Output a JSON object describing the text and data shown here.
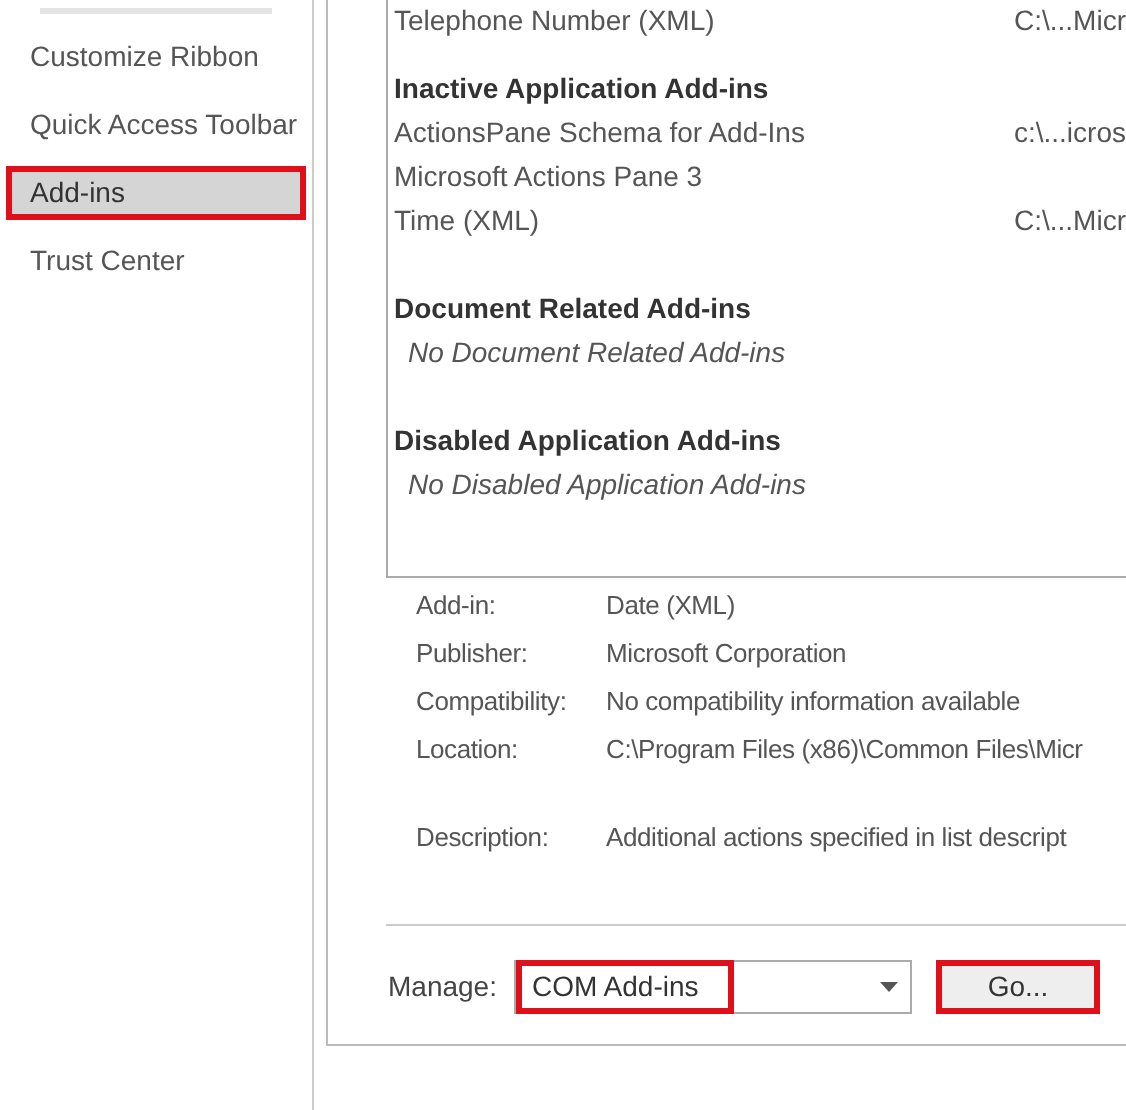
{
  "sidebar": {
    "items": [
      {
        "label": "Customize Ribbon",
        "selected": false,
        "highlighted": false
      },
      {
        "label": "Quick Access Toolbar",
        "selected": false,
        "highlighted": false
      },
      {
        "label": "Add-ins",
        "selected": true,
        "highlighted": true
      },
      {
        "label": "Trust Center",
        "selected": false,
        "highlighted": false
      }
    ]
  },
  "addins_list": {
    "top_rows": [
      {
        "name": "Telephone Number (XML)",
        "location": "C:\\...Micr"
      }
    ],
    "sections": [
      {
        "heading": "Inactive Application Add-ins",
        "rows": [
          {
            "name": "ActionsPane Schema for Add-Ins",
            "location": "c:\\...icros"
          },
          {
            "name": "Microsoft Actions Pane 3"
          },
          {
            "name": "Time (XML)",
            "location": "C:\\...Micr"
          }
        ]
      },
      {
        "heading": "Document Related Add-ins",
        "empty_text": "No Document Related Add-ins"
      },
      {
        "heading": "Disabled Application Add-ins",
        "empty_text": "No Disabled Application Add-ins"
      }
    ]
  },
  "details": [
    {
      "label": "Add-in:",
      "value": "Date (XML)"
    },
    {
      "label": "Publisher:",
      "value": "Microsoft Corporation"
    },
    {
      "label": "Compatibility:",
      "value": "No compatibility information available"
    },
    {
      "label": "Location:",
      "value": "C:\\Program Files (x86)\\Common Files\\Micr"
    },
    {
      "label": "Description:",
      "value": "Additional actions specified in list descript",
      "spaced": true
    }
  ],
  "manage": {
    "label": "Manage:",
    "value": "COM Add-ins",
    "highlighted": true
  },
  "go_button": {
    "label": "Go...",
    "highlighted": true
  }
}
